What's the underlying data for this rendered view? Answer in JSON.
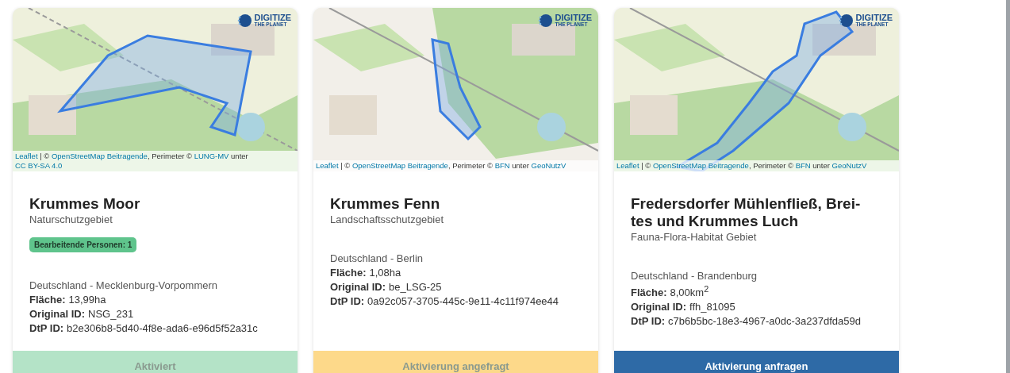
{
  "cards": [
    {
      "logo": {
        "line1": "DIGITIZE",
        "line2": "THE PLANET"
      },
      "attribution": [
        {
          "text": "Leaflet",
          "link": true
        },
        {
          "text": " | © ",
          "link": false
        },
        {
          "text": "OpenStreetMap Beitragende",
          "link": true
        },
        {
          "text": ", Perimeter © ",
          "link": false
        },
        {
          "text": "LUNG-MV",
          "link": true
        },
        {
          "text": " unter ",
          "link": false
        },
        {
          "text": "CC BY-SA 4.0",
          "link": true
        }
      ],
      "title": "Krummes Moor",
      "category": "Naturschutzgebiet",
      "badge": "Bearbeitende Personen: 1",
      "region": "Deutschland - Mecklenburg-Vorpommern",
      "fields": [
        {
          "label": "Fläche:",
          "value": "13,99ha"
        },
        {
          "label": "Original ID:",
          "value": "NSG_231"
        },
        {
          "label": "DtP ID:",
          "value": "b2e306b8-5d40-4f8e-ada6-e96d5f52a31c"
        }
      ],
      "action": {
        "kind": "activated",
        "label": "Aktiviert"
      }
    },
    {
      "logo": {
        "line1": "DIGITIZE",
        "line2": "THE PLANET"
      },
      "attribution": [
        {
          "text": "Leaflet",
          "link": true
        },
        {
          "text": " | © ",
          "link": false
        },
        {
          "text": "OpenStreetMap Beitragende",
          "link": true
        },
        {
          "text": ", Perimeter © ",
          "link": false
        },
        {
          "text": "BFN",
          "link": true
        },
        {
          "text": " unter ",
          "link": false
        },
        {
          "text": "GeoNutzV",
          "link": true
        }
      ],
      "title": "Krummes Fenn",
      "category": "Landschaftsschutzgebiet",
      "region": "Deutschland - Berlin",
      "fields": [
        {
          "label": "Fläche:",
          "value": "1,08ha"
        },
        {
          "label": "Original ID:",
          "value": "be_LSG-25"
        },
        {
          "label": "DtP ID:",
          "value": "0a92c057-3705-445c-9e11-4c11f974ee44"
        }
      ],
      "action": {
        "kind": "requested",
        "label": "Aktivierung angefragt"
      }
    },
    {
      "logo": {
        "line1": "DIGITIZE",
        "line2": "THE PLANET"
      },
      "attribution": [
        {
          "text": "Leaflet",
          "link": true
        },
        {
          "text": " | © ",
          "link": false
        },
        {
          "text": "OpenStreetMap Beitragende",
          "link": true
        },
        {
          "text": ", Perimeter © ",
          "link": false
        },
        {
          "text": "BFN",
          "link": true
        },
        {
          "text": " unter ",
          "link": false
        },
        {
          "text": "GeoNutzV",
          "link": true
        }
      ],
      "title": "Fredersdorfer Mühlenfließ, Brei-tes und Krummes Luch",
      "category": "Fauna-Flora-Habitat Gebiet",
      "region": "Deutschland - Brandenburg",
      "fields": [
        {
          "label": "Fläche:",
          "value": "8,00km$^{2}$"
        },
        {
          "label": "Original ID:",
          "value": "ffh_81095"
        },
        {
          "label": "DtP ID:",
          "value": "c7b6b5bc-18e3-4967-a0dc-3a237dfda59d"
        }
      ],
      "action": {
        "kind": "request",
        "label": "Aktivierung anfragen"
      }
    }
  ]
}
